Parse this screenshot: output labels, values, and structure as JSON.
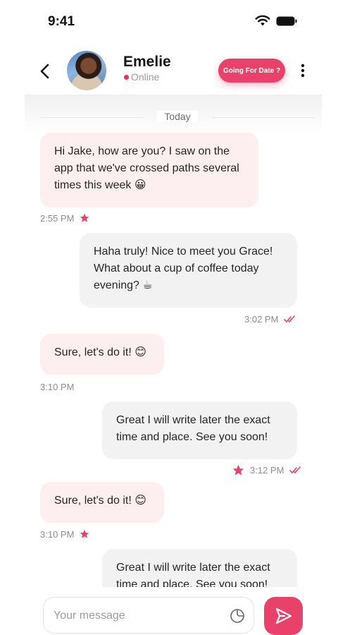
{
  "status_bar": {
    "time": "9:41"
  },
  "header": {
    "contact_name": "Emelie",
    "status": "Online",
    "date_button_label": "Going For Date ?"
  },
  "chat": {
    "date_separator": "Today",
    "messages": [
      {
        "direction": "incoming",
        "text": "Hi Jake, how are you? I saw on the app that we've crossed paths several times this week 😀",
        "time": "2:55 PM",
        "starred": true,
        "read": false
      },
      {
        "direction": "outgoing",
        "text": "Haha truly! Nice to meet you Grace! What about a cup of coffee today evening? ☕",
        "time": "3:02 PM",
        "starred": false,
        "read": true
      },
      {
        "direction": "incoming",
        "text": "Sure, let's do it! 😊",
        "time": "3:10 PM",
        "starred": false,
        "read": false
      },
      {
        "direction": "outgoing",
        "text": "Great I will write later the exact time and place. See you soon!",
        "time": "3:12 PM",
        "starred": true,
        "read": true
      },
      {
        "direction": "incoming",
        "text": "Sure, let's do it! 😊",
        "time": "3:10 PM",
        "starred": true,
        "read": false
      },
      {
        "direction": "outgoing",
        "text": "Great I will write later the exact time and place. See you soon!",
        "time": "",
        "starred": false,
        "read": false
      }
    ]
  },
  "composer": {
    "placeholder": "Your message"
  },
  "colors": {
    "accent": "#e8426a",
    "incoming_bubble": "#fdeef0",
    "outgoing_bubble": "#f2f2f2",
    "meta_text": "#8c8c8c"
  },
  "icons": [
    "wifi-icon",
    "battery-icon",
    "back-arrow-icon",
    "more-vertical-icon",
    "star-icon",
    "double-check-icon",
    "sticker-icon",
    "send-icon"
  ]
}
